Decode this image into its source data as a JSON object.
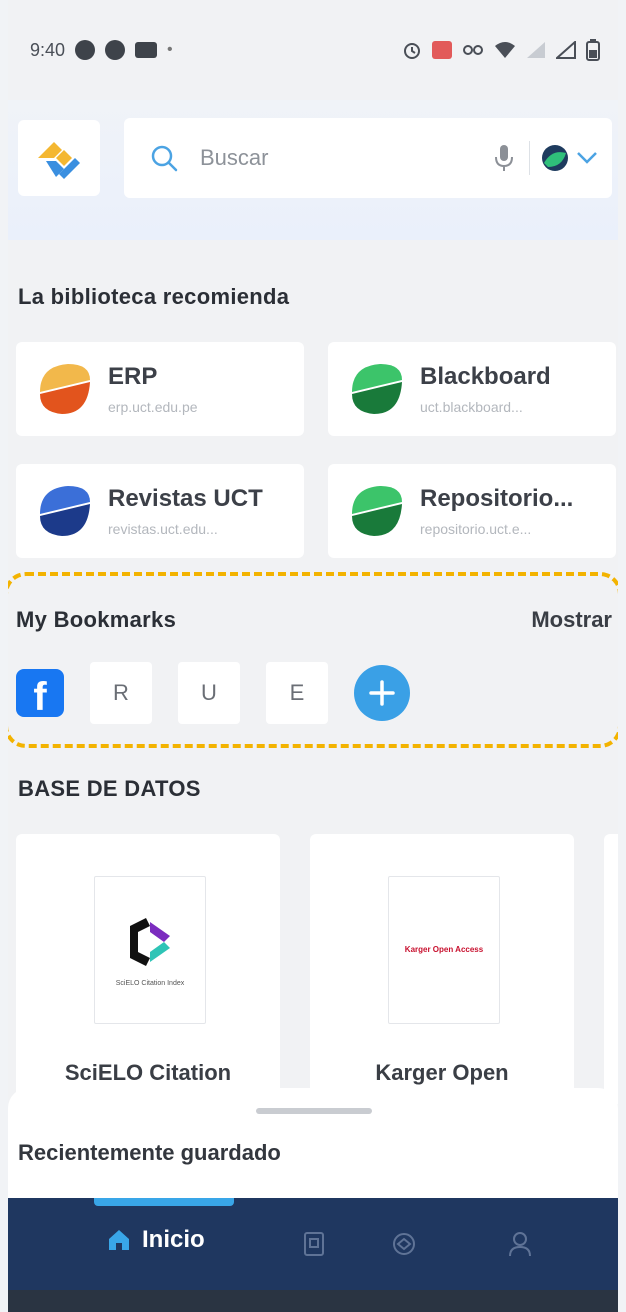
{
  "status_bar": {
    "time": "9:40"
  },
  "header": {
    "search": {
      "placeholder": "Buscar"
    }
  },
  "recommended": {
    "title": "La biblioteca recomienda",
    "items": [
      {
        "title": "ERP",
        "subtitle": "erp.uct.edu.pe",
        "color_top": "#f2b84b",
        "color_bottom": "#e2541d"
      },
      {
        "title": "Blackboard",
        "subtitle": "uct.blackboard...",
        "color_top": "#3cc46a",
        "color_bottom": "#197a3a"
      },
      {
        "title": "Revistas UCT",
        "subtitle": "revistas.uct.edu...",
        "color_top": "#3b6fd8",
        "color_bottom": "#1c3a8a"
      },
      {
        "title": "Repositorio...",
        "subtitle": "repositorio.uct.e...",
        "color_top": "#3cc46a",
        "color_bottom": "#197a3a"
      }
    ]
  },
  "bookmarks": {
    "title": "My Bookmarks",
    "show_label": "Mostrar",
    "tiles": [
      "R",
      "U",
      "E"
    ]
  },
  "databases": {
    "title": "BASE DE DATOS",
    "items": [
      {
        "name": "SciELO Citation",
        "logo_text": "SciELO Citation Index"
      },
      {
        "name": "Karger Open",
        "logo_text": "Karger Open Access"
      }
    ]
  },
  "sheet": {
    "title": "Recientemente guardado"
  },
  "nav": {
    "home_label": "Inicio"
  },
  "colors": {
    "nav_bg": "#1f3760",
    "accent": "#39a6e8",
    "highlight": "#f3b300"
  }
}
